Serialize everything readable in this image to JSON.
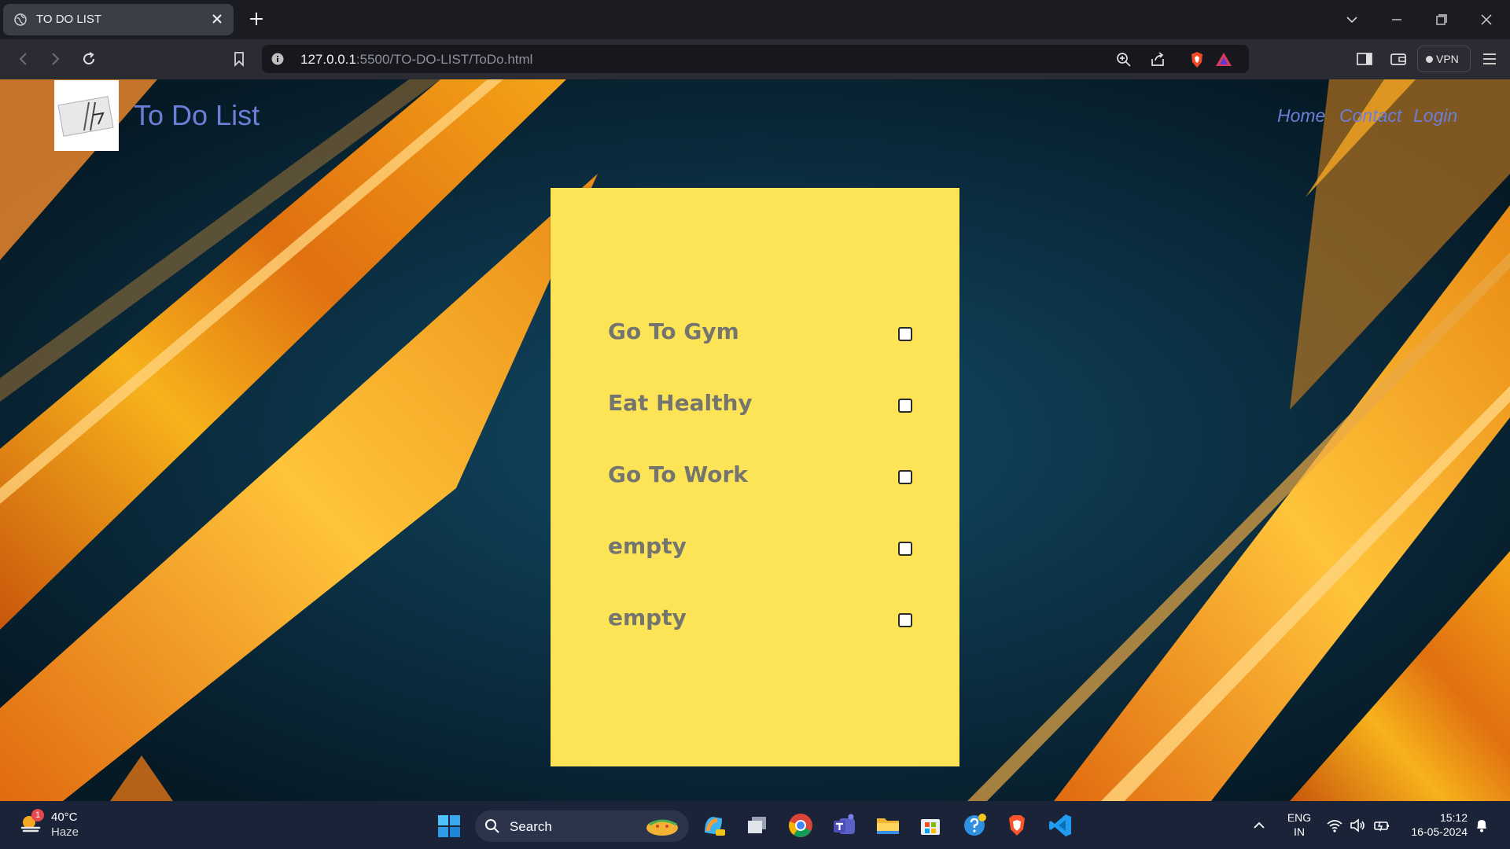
{
  "browser": {
    "tab_title": "TO DO LIST",
    "url_host": "127.0.0.1",
    "url_rest": ":5500/TO-DO-LIST/ToDo.html",
    "vpn_label": "VPN"
  },
  "site": {
    "brand_title": "To Do List",
    "nav": [
      "Home",
      "Contact",
      "Login"
    ],
    "colors": {
      "brand": "#6b7fd8",
      "note": "#fde457",
      "item_text": "#74756f"
    }
  },
  "todos": [
    {
      "label": "Go To Gym",
      "checked": false
    },
    {
      "label": "Eat Healthy",
      "checked": false
    },
    {
      "label": "Go To Work",
      "checked": false
    },
    {
      "label": "empty",
      "checked": false
    },
    {
      "label": "empty",
      "checked": false
    }
  ],
  "taskbar": {
    "weather_badge": "1",
    "temperature": "40°C",
    "condition": "Haze",
    "search_label": "Search",
    "language_top": "ENG",
    "language_bottom": "IN",
    "time": "15:12",
    "date": "16-05-2024",
    "apps": [
      "copilot-icon",
      "task-view-icon",
      "chrome-icon",
      "teams-icon",
      "file-explorer-icon",
      "store-icon",
      "help-icon",
      "brave-icon",
      "vscode-icon"
    ]
  }
}
